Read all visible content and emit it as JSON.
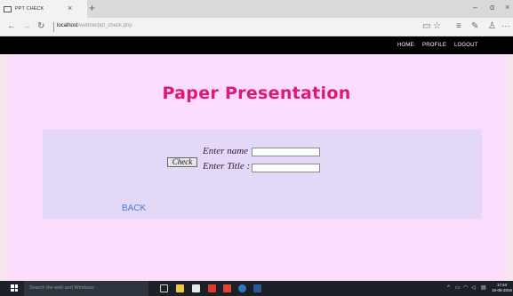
{
  "browser": {
    "tab_title": "PPT CHECK",
    "tab_close": "×",
    "new_tab": "+",
    "window_controls": {
      "minimize": "–",
      "maximize": "ɑ",
      "close": "×"
    },
    "nav": {
      "back": "←",
      "forward": "→",
      "refresh": "↻"
    },
    "url_host": "localhost",
    "url_path": "/webhw/ppt_check.php",
    "toolbar_icons": [
      "reading-view-icon",
      "favorite-icon",
      "hub-icon",
      "note-icon",
      "share-icon",
      "more-icon"
    ],
    "toolbar_glyphs": {
      "reading": "▭",
      "favorite": "☆",
      "hub": "≡",
      "note": "✎",
      "share": "♙",
      "more": "···"
    }
  },
  "site_nav": {
    "home": "HOME",
    "profile": "PROFILE",
    "logout": "LOGOUT"
  },
  "page": {
    "heading": "Paper Presentation",
    "form": {
      "name_label": "Enter name",
      "name_value": "",
      "title_label": "Enter Title :",
      "title_value": "",
      "submit_label": "Check"
    },
    "back_link": "BACK"
  },
  "taskbar": {
    "search_placeholder": "Search the web and Windows",
    "apps": [
      "task-view-icon",
      "file-explorer-icon",
      "store-icon",
      "mail-icon",
      "office-icon",
      "edge-icon",
      "word-icon"
    ],
    "clock_time": "17:44",
    "clock_date": "15-06-2016"
  },
  "colors": {
    "heading": "#e0167a",
    "page_bg": "#fcdcfc",
    "panel_bg": "#e4d8f8",
    "nav_bg": "#000000",
    "link": "#3f7fd2",
    "taskbar_bg": "#1c2027"
  }
}
